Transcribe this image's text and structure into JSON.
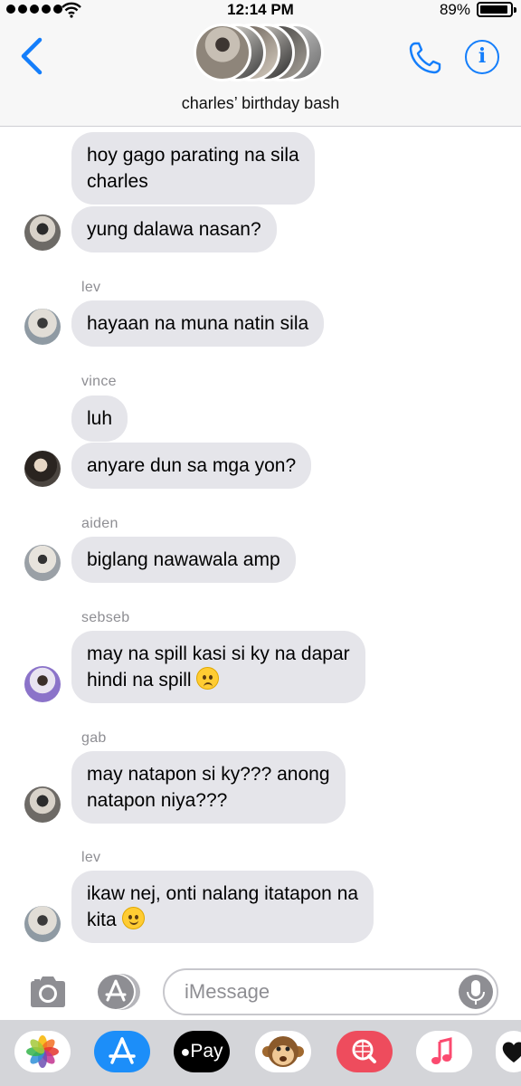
{
  "status_bar": {
    "time": "12:14 PM",
    "battery_percent": "89%",
    "battery_level": 0.89,
    "signal_dots": 5
  },
  "header": {
    "group_name": "charles’ birthday bash"
  },
  "messages": [
    {
      "sender": "",
      "lines": [
        "hoy gago parating na sila",
        "charles"
      ]
    },
    {
      "sender": "",
      "lines": [
        "yung dalawa nasan?"
      ]
    },
    {
      "sender": "lev",
      "lines": [
        "hayaan na muna natin sila"
      ]
    },
    {
      "sender": "vince",
      "lines": [
        "luh"
      ]
    },
    {
      "sender": "",
      "lines": [
        "anyare dun sa mga yon?"
      ]
    },
    {
      "sender": "aiden",
      "lines": [
        "biglang nawawala amp"
      ]
    },
    {
      "sender": "sebseb",
      "lines": [
        "may na spill kasi si ky na dapar",
        "hindi na spill"
      ],
      "emoji": "pensive-face-icon"
    },
    {
      "sender": "gab",
      "lines": [
        "may natapon si ky??? anong",
        "natapon niya???"
      ]
    },
    {
      "sender": "lev",
      "lines": [
        "ikaw nej, onti nalang itatapon na",
        "kita"
      ],
      "emoji": "slightly-smiling-face-icon"
    }
  ],
  "input": {
    "placeholder": "iMessage"
  },
  "drawer": {
    "apple_pay_label": "Pay"
  },
  "colors": {
    "accent": "#147efb",
    "bubble_gray": "#e5e5ea",
    "sender_gray": "#8e8e93"
  }
}
